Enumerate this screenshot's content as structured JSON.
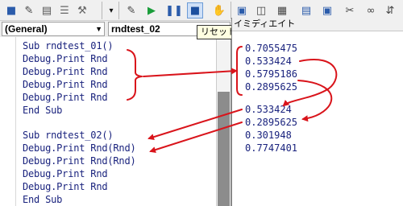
{
  "toolbar": {
    "buttons": [
      "stop-square-icon",
      "design-mode-icon",
      "project-explorer-icon",
      "properties-icon",
      "toolbox-icon",
      "run-icon",
      "break-icon",
      "reset-icon",
      "hand-icon",
      "window-icon"
    ]
  },
  "code": {
    "object_combo": "(General)",
    "procedure_combo": "rndtest_02",
    "reset_tooltip": "リセット",
    "lines": [
      "Sub rndtest_01()",
      "Debug.Print Rnd",
      "Debug.Print Rnd",
      "Debug.Print Rnd",
      "Debug.Print Rnd",
      "End Sub",
      "",
      "Sub rndtest_02()",
      "Debug.Print Rnd(Rnd)",
      "Debug.Print Rnd(Rnd)",
      "Debug.Print Rnd",
      "Debug.Print Rnd",
      "End Sub"
    ]
  },
  "immediate": {
    "title": "イミディエイト",
    "lines": [
      "0.7055475",
      "0.533424",
      "0.5795186",
      "0.2895625",
      "0.533424",
      "0.2895625",
      "0.301948",
      "0.7747401"
    ]
  },
  "colors": {
    "annotation": "#d9141b",
    "code_text": "#1a237e"
  }
}
